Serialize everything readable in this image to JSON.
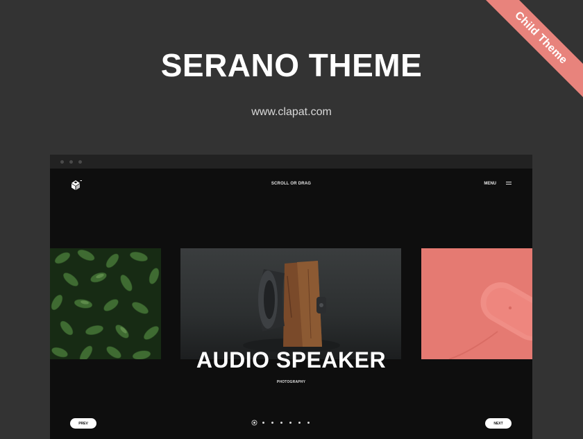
{
  "ribbon": {
    "label": "Child Theme",
    "color": "#e8837c"
  },
  "header": {
    "title": "SERANO THEME",
    "url": "www.clapat.com"
  },
  "browser": {
    "nav": {
      "logo_icon": "cube-logo-icon",
      "scroll_hint": "SCROLL OR DRAG",
      "menu_label": "MENU",
      "menu_icon": "hamburger-icon"
    },
    "slides": [
      {
        "image": "green-leaves-photo"
      },
      {
        "image": "wooden-audio-speaker-photo"
      },
      {
        "image": "coral-pink-object-photo"
      }
    ],
    "active_slide": {
      "title": "AUDIO SPEAKER",
      "category": "PHOTOGRAPHY"
    },
    "pagination": {
      "count": 7,
      "active_index": 0
    },
    "controls": {
      "prev_label": "PREV",
      "next_label": "NEXT"
    }
  },
  "colors": {
    "page_bg": "#333333",
    "browser_bg": "#0e0e0e",
    "accent": "#e8837c"
  }
}
